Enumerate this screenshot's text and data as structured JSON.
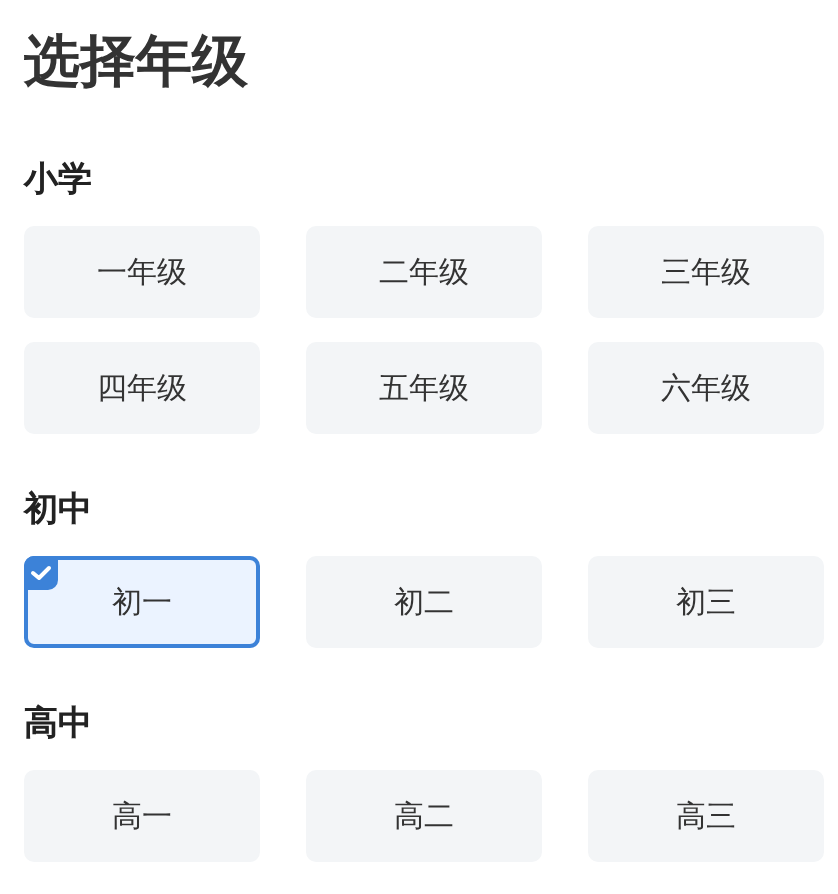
{
  "title": "选择年级",
  "sections": [
    {
      "heading": "小学",
      "options": [
        {
          "label": "一年级",
          "selected": false
        },
        {
          "label": "二年级",
          "selected": false
        },
        {
          "label": "三年级",
          "selected": false
        },
        {
          "label": "四年级",
          "selected": false
        },
        {
          "label": "五年级",
          "selected": false
        },
        {
          "label": "六年级",
          "selected": false
        }
      ]
    },
    {
      "heading": "初中",
      "options": [
        {
          "label": "初一",
          "selected": true
        },
        {
          "label": "初二",
          "selected": false
        },
        {
          "label": "初三",
          "selected": false
        }
      ]
    },
    {
      "heading": "高中",
      "options": [
        {
          "label": "高一",
          "selected": false
        },
        {
          "label": "高二",
          "selected": false
        },
        {
          "label": "高三",
          "selected": false
        }
      ]
    }
  ]
}
